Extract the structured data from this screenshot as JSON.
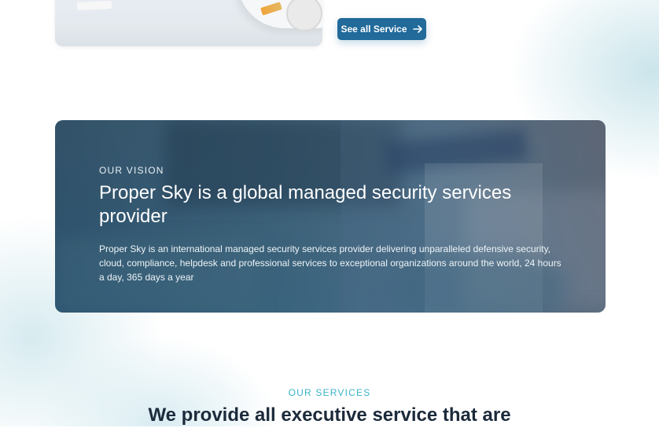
{
  "top": {
    "see_all_label": "See all Service"
  },
  "vision": {
    "eyebrow": "OUR VISION",
    "headline": "Proper Sky is a global managed security services provider",
    "description": "Proper Sky is an international managed security services provider delivering unparalleled defensive security, cloud, compliance, helpdesk and professional services to exceptional organizations around the world, 24 hours a day, 365 days a year"
  },
  "services": {
    "eyebrow": "OUR SERVICES",
    "title": "We provide all executive service that are"
  },
  "colors": {
    "button": "#216a9a",
    "accent": "#3bb3c8",
    "heading": "#1c2a3b"
  },
  "icons": {
    "see_all": "arrow-right-icon"
  }
}
